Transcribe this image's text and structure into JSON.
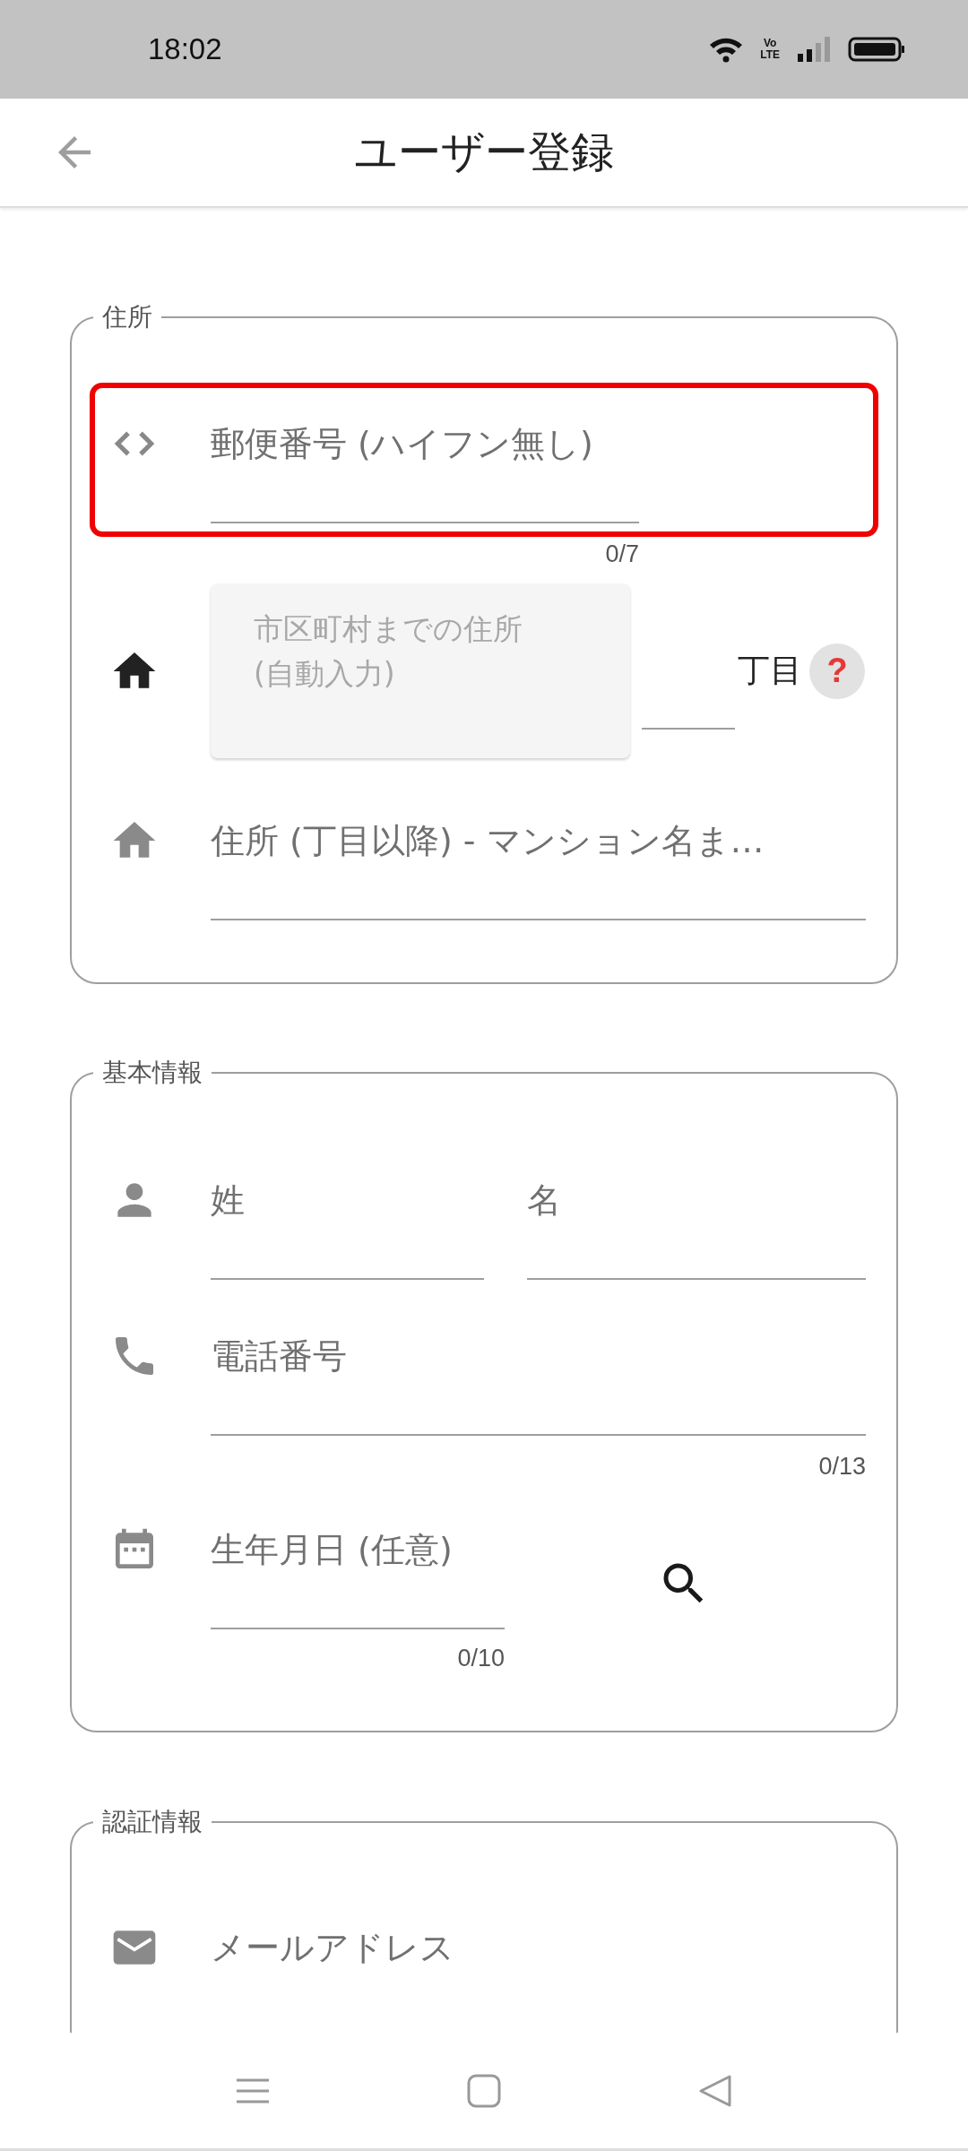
{
  "status_bar": {
    "time": "18:02",
    "network": [
      "Vo",
      "LTE"
    ]
  },
  "app_bar": {
    "title": "ユーザー登録"
  },
  "sections": [
    {
      "legend": "住所",
      "rows": [
        {
          "kind": "postal",
          "highlighted": true,
          "fields": [
            {
              "placeholder": "郵便番号 (ハイフン無し)",
              "counter": "0/7"
            }
          ]
        },
        {
          "kind": "auto_address",
          "highlighted": false,
          "disabled_lines": [
            "市区町村までの住所",
            "(自動入力)"
          ],
          "suffix": "丁目",
          "help": "?"
        },
        {
          "kind": "address_detail",
          "highlighted": false,
          "fields": [
            {
              "placeholder": "住所 (丁目以降) - マンション名ま…"
            }
          ]
        }
      ]
    },
    {
      "legend": "基本情報",
      "rows": [
        {
          "kind": "name",
          "highlighted": false,
          "fields": [
            {
              "placeholder": "姓"
            },
            {
              "placeholder": "名"
            }
          ]
        },
        {
          "kind": "phone",
          "highlighted": false,
          "fields": [
            {
              "placeholder": "電話番号",
              "counter": "0/13"
            }
          ]
        },
        {
          "kind": "date",
          "highlighted": false,
          "fields": [
            {
              "placeholder": "生年月日 (任意)",
              "counter": "0/10"
            }
          ]
        }
      ]
    },
    {
      "legend": "認証情報",
      "rows": [
        {
          "kind": "email",
          "highlighted": false,
          "fields": [
            {
              "placeholder": "メールアドレス"
            }
          ]
        }
      ]
    }
  ]
}
